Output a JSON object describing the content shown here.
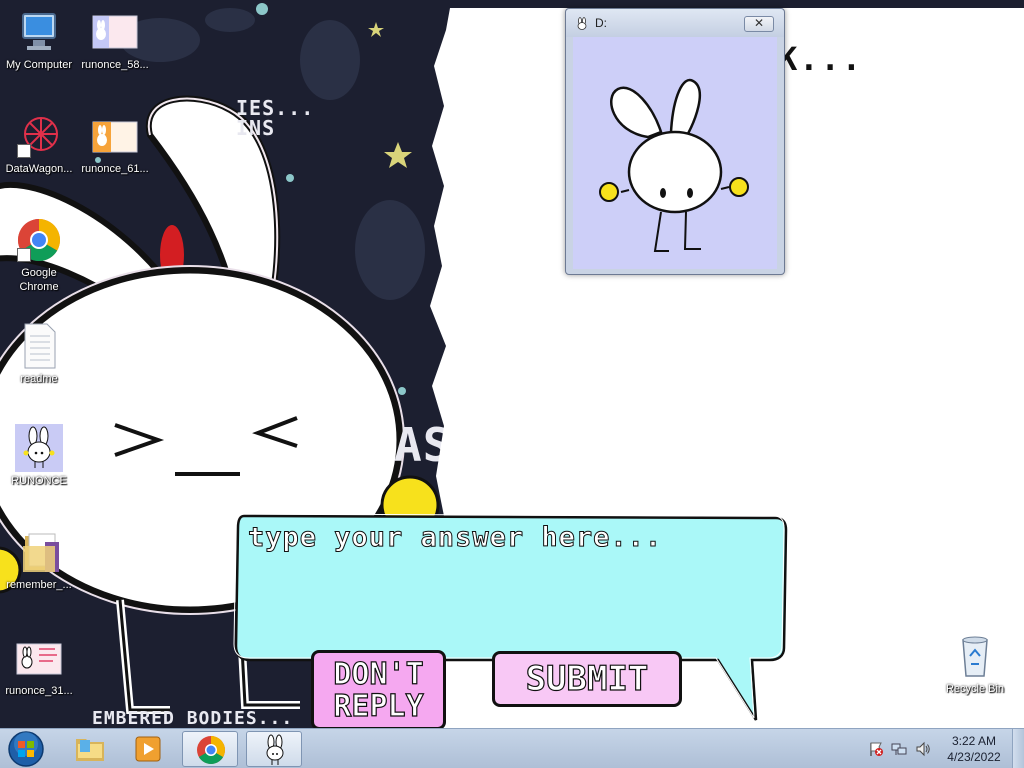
{
  "desktop": {
    "icons": [
      {
        "label": "My Computer",
        "icon": "computer-icon"
      },
      {
        "label": "runonce_58...",
        "icon": "image-file-icon"
      },
      {
        "label": "DataWagon...",
        "icon": "datawagon-shortcut-icon"
      },
      {
        "label": "runonce_61...",
        "icon": "image-file-icon"
      },
      {
        "label": "Google Chrome",
        "icon": "chrome-icon"
      },
      {
        "label": "readme",
        "icon": "text-file-icon"
      },
      {
        "label": "RUNONCE",
        "icon": "bunny-app-icon"
      },
      {
        "label": "remember_...",
        "icon": "folder-icon"
      },
      {
        "label": "runonce_31...",
        "icon": "image-file-icon"
      },
      {
        "label": "Recycle Bin",
        "icon": "recycle-bin-icon"
      }
    ],
    "wallpaper_text": [
      "IES...",
      "INS",
      "AS",
      "EMBERED BODIES..."
    ]
  },
  "popup": {
    "title": "D:",
    "close_label": "✕"
  },
  "big_window": {
    "text": "K..."
  },
  "answer": {
    "placeholder": "type your answer here...",
    "value": ""
  },
  "buttons": {
    "dont_reply": "DON'T\nREPLY",
    "submit": "SUBMIT"
  },
  "taskbar": {
    "apps": [
      {
        "name": "explorer",
        "icon": "folder-icon"
      },
      {
        "name": "media-player",
        "icon": "media-player-icon"
      },
      {
        "name": "chrome",
        "icon": "chrome-icon"
      },
      {
        "name": "runonce",
        "icon": "bunny-app-icon"
      }
    ],
    "clock": {
      "time": "3:22 AM",
      "date": "4/23/2022"
    }
  },
  "colors": {
    "bubble": "#aaf8f8",
    "dont_reply": "#f5a8f0",
    "submit": "#f8c8f5",
    "popup_client": "#cdcff8",
    "wallpaper": "#1c1f30"
  }
}
